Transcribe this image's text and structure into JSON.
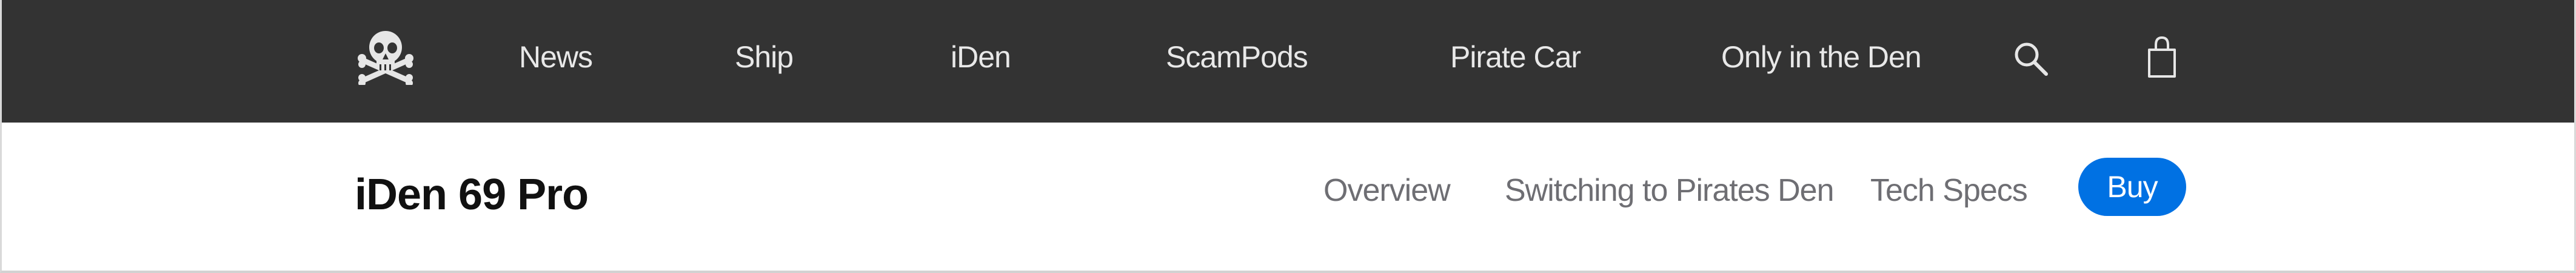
{
  "globalnav": {
    "logo_icon": "skull-crossbones-icon",
    "items": [
      {
        "label": "News"
      },
      {
        "label": "Ship"
      },
      {
        "label": "iDen"
      },
      {
        "label": "ScamPods"
      },
      {
        "label": "Pirate Car"
      },
      {
        "label": "Only in the Den"
      }
    ],
    "search_icon": "search-icon",
    "bag_icon": "shopping-bag-icon",
    "background_color": "#333333",
    "text_color": "#e8e8e8"
  },
  "localnav": {
    "title": "iDen 69 Pro",
    "links": [
      {
        "label": "Overview"
      },
      {
        "label": "Switching to Pirates Den"
      },
      {
        "label": "Tech Specs"
      }
    ],
    "buy_label": "Buy",
    "accent_color": "#0071e3"
  }
}
